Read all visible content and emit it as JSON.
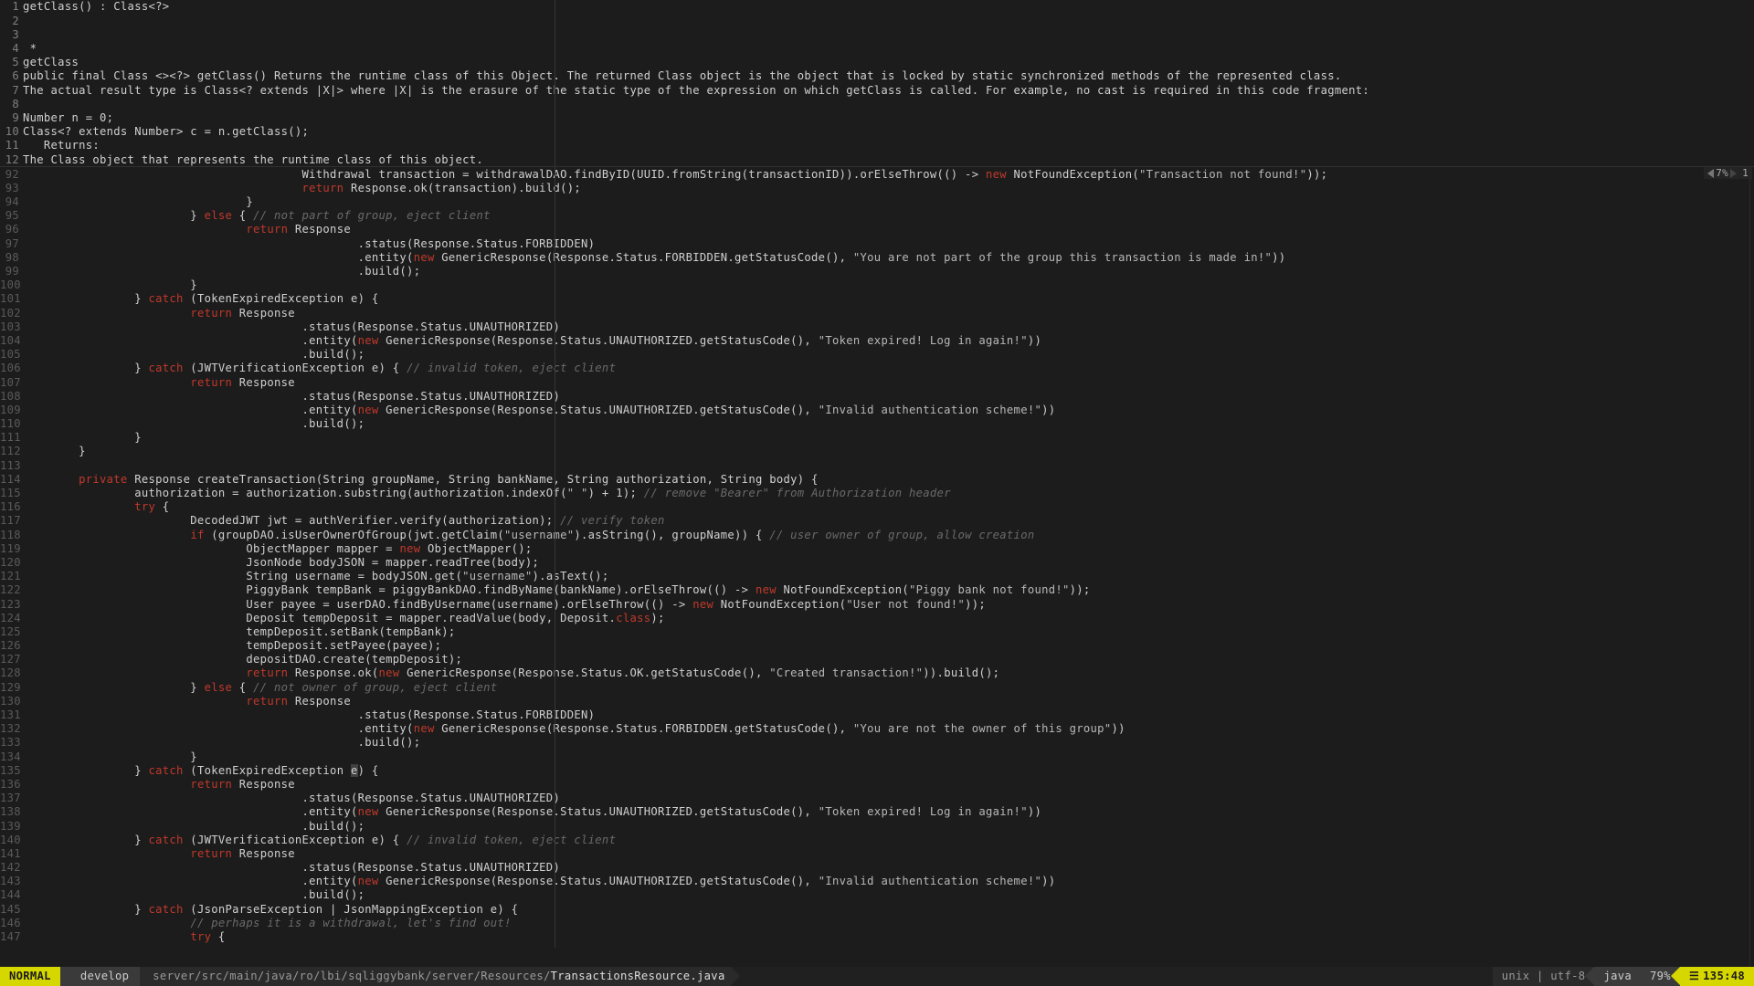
{
  "status": {
    "mode": "NORMAL",
    "branch_icon": "",
    "branch": "develop",
    "path_prefix": "server/src/main/java/ro/lbi/sqliggybank/server/Resources/",
    "file": "TransactionsResource.java",
    "encoding": "unix | utf-8",
    "filetype": "java",
    "percent": "79%",
    "position": "135:48"
  },
  "top_indicator": {
    "zoom": "7%",
    "count": "1"
  },
  "preview_lines": [
    {
      "n": "1",
      "tokens": [
        {
          "t": "getClass() : Class<?>",
          "c": ""
        }
      ]
    },
    {
      "n": "2",
      "tokens": []
    },
    {
      "n": "3",
      "tokens": []
    },
    {
      "n": "4",
      "tokens": [
        {
          "t": " *",
          "c": ""
        }
      ]
    },
    {
      "n": "5",
      "tokens": [
        {
          "t": "getClass",
          "c": ""
        }
      ]
    },
    {
      "n": "6",
      "tokens": [
        {
          "t": "public final Class <><?> getClass() Returns the runtime class of this Object. The returned Class object is the object that is locked by static synchronized methods of the represented class.",
          "c": ""
        }
      ]
    },
    {
      "n": "7",
      "tokens": [
        {
          "t": "The actual result type is Class<? extends |X|> where |X| is the erasure of the static type of the expression on which getClass is called. For example, no cast is required in this code fragment:",
          "c": ""
        }
      ]
    },
    {
      "n": "8",
      "tokens": []
    },
    {
      "n": "9",
      "tokens": [
        {
          "t": "Number n = 0;",
          "c": ""
        }
      ]
    },
    {
      "n": "10",
      "tokens": [
        {
          "t": "Class<? extends Number> c = n.getClass();",
          "c": ""
        }
      ]
    },
    {
      "n": "11",
      "tokens": [
        {
          "t": "   Returns:",
          "c": ""
        }
      ]
    },
    {
      "n": "12",
      "tokens": [
        {
          "t": "The Class object that represents the runtime class of this object.",
          "c": ""
        }
      ]
    }
  ],
  "main_lines": [
    {
      "n": "92",
      "tokens": [
        {
          "t": "                                        Withdrawal transaction = withdrawalDAO.findByID(UUID.fromString(transactionID)).orElseThrow(() -> ",
          "c": ""
        },
        {
          "t": "new",
          "c": "kw"
        },
        {
          "t": " NotFoundException(",
          "c": ""
        },
        {
          "t": "\"Transaction not found!\"",
          "c": "str"
        },
        {
          "t": "));",
          "c": ""
        }
      ]
    },
    {
      "n": "93",
      "tokens": [
        {
          "t": "                                        ",
          "c": ""
        },
        {
          "t": "return",
          "c": "kw"
        },
        {
          "t": " Response.ok(transaction).build();",
          "c": ""
        }
      ]
    },
    {
      "n": "94",
      "tokens": [
        {
          "t": "                                }",
          "c": ""
        }
      ]
    },
    {
      "n": "95",
      "tokens": [
        {
          "t": "                        } ",
          "c": ""
        },
        {
          "t": "else",
          "c": "kw"
        },
        {
          "t": " { ",
          "c": ""
        },
        {
          "t": "// not part of group, eject client",
          "c": "cm"
        }
      ]
    },
    {
      "n": "96",
      "tokens": [
        {
          "t": "                                ",
          "c": ""
        },
        {
          "t": "return",
          "c": "kw"
        },
        {
          "t": " Response",
          "c": ""
        }
      ]
    },
    {
      "n": "97",
      "tokens": [
        {
          "t": "                                                .status(Response.Status.FORBIDDEN)",
          "c": ""
        }
      ]
    },
    {
      "n": "98",
      "tokens": [
        {
          "t": "                                                .entity(",
          "c": ""
        },
        {
          "t": "new",
          "c": "kw"
        },
        {
          "t": " GenericResponse(Response.Status.FORBIDDEN.getStatusCode(), ",
          "c": ""
        },
        {
          "t": "\"You are not part of the group this transaction is made in!\"",
          "c": "str"
        },
        {
          "t": "))",
          "c": ""
        }
      ]
    },
    {
      "n": "99",
      "tokens": [
        {
          "t": "                                                .build();",
          "c": ""
        }
      ]
    },
    {
      "n": "100",
      "tokens": [
        {
          "t": "                        }",
          "c": ""
        }
      ]
    },
    {
      "n": "101",
      "tokens": [
        {
          "t": "                } ",
          "c": ""
        },
        {
          "t": "catch",
          "c": "kw"
        },
        {
          "t": " (TokenExpiredException e) {",
          "c": ""
        }
      ]
    },
    {
      "n": "102",
      "tokens": [
        {
          "t": "                        ",
          "c": ""
        },
        {
          "t": "return",
          "c": "kw"
        },
        {
          "t": " Response",
          "c": ""
        }
      ]
    },
    {
      "n": "103",
      "tokens": [
        {
          "t": "                                        .status(Response.Status.UNAUTHORIZED)",
          "c": ""
        }
      ]
    },
    {
      "n": "104",
      "tokens": [
        {
          "t": "                                        .entity(",
          "c": ""
        },
        {
          "t": "new",
          "c": "kw"
        },
        {
          "t": " GenericResponse(Response.Status.UNAUTHORIZED.getStatusCode(), ",
          "c": ""
        },
        {
          "t": "\"Token expired! Log in again!\"",
          "c": "str"
        },
        {
          "t": "))",
          "c": ""
        }
      ]
    },
    {
      "n": "105",
      "tokens": [
        {
          "t": "                                        .build();",
          "c": ""
        }
      ]
    },
    {
      "n": "106",
      "tokens": [
        {
          "t": "                } ",
          "c": ""
        },
        {
          "t": "catch",
          "c": "kw"
        },
        {
          "t": " (JWTVerificationException e) { ",
          "c": ""
        },
        {
          "t": "// invalid token, eject client",
          "c": "cm"
        }
      ]
    },
    {
      "n": "107",
      "tokens": [
        {
          "t": "                        ",
          "c": ""
        },
        {
          "t": "return",
          "c": "kw"
        },
        {
          "t": " Response",
          "c": ""
        }
      ]
    },
    {
      "n": "108",
      "tokens": [
        {
          "t": "                                        .status(Response.Status.UNAUTHORIZED)",
          "c": ""
        }
      ]
    },
    {
      "n": "109",
      "tokens": [
        {
          "t": "                                        .entity(",
          "c": ""
        },
        {
          "t": "new",
          "c": "kw"
        },
        {
          "t": " GenericResponse(Response.Status.UNAUTHORIZED.getStatusCode(), ",
          "c": ""
        },
        {
          "t": "\"Invalid authentication scheme!\"",
          "c": "str"
        },
        {
          "t": "))",
          "c": ""
        }
      ]
    },
    {
      "n": "110",
      "tokens": [
        {
          "t": "                                        .build();",
          "c": ""
        }
      ]
    },
    {
      "n": "111",
      "tokens": [
        {
          "t": "                }",
          "c": ""
        }
      ]
    },
    {
      "n": "112",
      "tokens": [
        {
          "t": "        }",
          "c": ""
        }
      ]
    },
    {
      "n": "113",
      "tokens": []
    },
    {
      "n": "114",
      "tokens": [
        {
          "t": "        ",
          "c": ""
        },
        {
          "t": "private",
          "c": "kw"
        },
        {
          "t": " Response createTransaction(String groupName, String bankName, String authorization, String body) {",
          "c": ""
        }
      ]
    },
    {
      "n": "115",
      "tokens": [
        {
          "t": "                authorization = authorization.substring(authorization.indexOf(",
          "c": ""
        },
        {
          "t": "\" \"",
          "c": "str"
        },
        {
          "t": ") + ",
          "c": ""
        },
        {
          "t": "1",
          "c": ""
        },
        {
          "t": "); ",
          "c": ""
        },
        {
          "t": "// remove \"Bearer\" from Authorization header",
          "c": "cm"
        }
      ]
    },
    {
      "n": "116",
      "tokens": [
        {
          "t": "                ",
          "c": ""
        },
        {
          "t": "try",
          "c": "kw"
        },
        {
          "t": " {",
          "c": ""
        }
      ]
    },
    {
      "n": "117",
      "tokens": [
        {
          "t": "                        DecodedJWT jwt = authVerifier.verify(authorization); ",
          "c": ""
        },
        {
          "t": "// verify token",
          "c": "cm"
        }
      ]
    },
    {
      "n": "118",
      "tokens": [
        {
          "t": "                        ",
          "c": ""
        },
        {
          "t": "if",
          "c": "kw"
        },
        {
          "t": " (groupDAO.isUserOwnerOfGroup(jwt.getClaim(",
          "c": ""
        },
        {
          "t": "\"username\"",
          "c": "str"
        },
        {
          "t": ").asString(), groupName)) { ",
          "c": ""
        },
        {
          "t": "// user owner of group, allow creation",
          "c": "cm"
        }
      ]
    },
    {
      "n": "119",
      "tokens": [
        {
          "t": "                                ObjectMapper mapper = ",
          "c": ""
        },
        {
          "t": "new",
          "c": "kw"
        },
        {
          "t": " ObjectMapper();",
          "c": ""
        }
      ]
    },
    {
      "n": "120",
      "tokens": [
        {
          "t": "                                JsonNode bodyJSON = mapper.readTree(body);",
          "c": ""
        }
      ]
    },
    {
      "n": "121",
      "tokens": [
        {
          "t": "                                String username = bodyJSON.get(",
          "c": ""
        },
        {
          "t": "\"username\"",
          "c": "str"
        },
        {
          "t": ").asText();",
          "c": ""
        }
      ]
    },
    {
      "n": "122",
      "tokens": [
        {
          "t": "                                PiggyBank tempBank = piggyBankDAO.findByName(bankName).orElseThrow(() -> ",
          "c": ""
        },
        {
          "t": "new",
          "c": "kw"
        },
        {
          "t": " NotFoundException(",
          "c": ""
        },
        {
          "t": "\"Piggy bank not found!\"",
          "c": "str"
        },
        {
          "t": "));",
          "c": ""
        }
      ]
    },
    {
      "n": "123",
      "tokens": [
        {
          "t": "                                User payee = userDAO.findByUsername(username).orElseThrow(() -> ",
          "c": ""
        },
        {
          "t": "new",
          "c": "kw"
        },
        {
          "t": " NotFoundException(",
          "c": ""
        },
        {
          "t": "\"User not found!\"",
          "c": "str"
        },
        {
          "t": "));",
          "c": ""
        }
      ]
    },
    {
      "n": "124",
      "tokens": [
        {
          "t": "                                Deposit tempDeposit = mapper.readValue(body, Deposit.",
          "c": ""
        },
        {
          "t": "class",
          "c": "kw"
        },
        {
          "t": ");",
          "c": ""
        }
      ]
    },
    {
      "n": "125",
      "tokens": [
        {
          "t": "                                tempDeposit.setBank(tempBank);",
          "c": ""
        }
      ]
    },
    {
      "n": "126",
      "tokens": [
        {
          "t": "                                tempDeposit.setPayee(payee);",
          "c": ""
        }
      ]
    },
    {
      "n": "127",
      "tokens": [
        {
          "t": "                                depositDAO.create(tempDeposit);",
          "c": ""
        }
      ]
    },
    {
      "n": "128",
      "tokens": [
        {
          "t": "                                ",
          "c": ""
        },
        {
          "t": "return",
          "c": "kw"
        },
        {
          "t": " Response.ok(",
          "c": ""
        },
        {
          "t": "new",
          "c": "kw"
        },
        {
          "t": " GenericResponse(Response.Status.OK.getStatusCode(), ",
          "c": ""
        },
        {
          "t": "\"Created transaction!\"",
          "c": "str"
        },
        {
          "t": ")).build();",
          "c": ""
        }
      ]
    },
    {
      "n": "129",
      "tokens": [
        {
          "t": "                        } ",
          "c": ""
        },
        {
          "t": "else",
          "c": "kw"
        },
        {
          "t": " { ",
          "c": ""
        },
        {
          "t": "// not owner of group, eject client",
          "c": "cm"
        }
      ]
    },
    {
      "n": "130",
      "tokens": [
        {
          "t": "                                ",
          "c": ""
        },
        {
          "t": "return",
          "c": "kw"
        },
        {
          "t": " Response",
          "c": ""
        }
      ]
    },
    {
      "n": "131",
      "tokens": [
        {
          "t": "                                                .status(Response.Status.FORBIDDEN)",
          "c": ""
        }
      ]
    },
    {
      "n": "132",
      "tokens": [
        {
          "t": "                                                .entity(",
          "c": ""
        },
        {
          "t": "new",
          "c": "kw"
        },
        {
          "t": " GenericResponse(Response.Status.FORBIDDEN.getStatusCode(), ",
          "c": ""
        },
        {
          "t": "\"You are not the owner of this group\"",
          "c": "str"
        },
        {
          "t": "))",
          "c": ""
        }
      ]
    },
    {
      "n": "133",
      "tokens": [
        {
          "t": "                                                .build();",
          "c": ""
        }
      ]
    },
    {
      "n": "134",
      "tokens": [
        {
          "t": "                        }",
          "c": ""
        }
      ]
    },
    {
      "n": "135",
      "tokens": [
        {
          "t": "                } ",
          "c": ""
        },
        {
          "t": "catch",
          "c": "kw"
        },
        {
          "t": " (TokenExpiredException ",
          "c": ""
        },
        {
          "t": "e",
          "c": "cursor-mark"
        },
        {
          "t": ") {",
          "c": ""
        }
      ]
    },
    {
      "n": "136",
      "tokens": [
        {
          "t": "                        ",
          "c": ""
        },
        {
          "t": "return",
          "c": "kw"
        },
        {
          "t": " Response",
          "c": ""
        }
      ]
    },
    {
      "n": "137",
      "tokens": [
        {
          "t": "                                        .status(Response.Status.UNAUTHORIZED)",
          "c": ""
        }
      ]
    },
    {
      "n": "138",
      "tokens": [
        {
          "t": "                                        .entity(",
          "c": ""
        },
        {
          "t": "new",
          "c": "kw"
        },
        {
          "t": " GenericResponse(Response.Status.UNAUTHORIZED.getStatusCode(), ",
          "c": ""
        },
        {
          "t": "\"Token expired! Log in again!\"",
          "c": "str"
        },
        {
          "t": "))",
          "c": ""
        }
      ]
    },
    {
      "n": "139",
      "tokens": [
        {
          "t": "                                        .build();",
          "c": ""
        }
      ]
    },
    {
      "n": "140",
      "tokens": [
        {
          "t": "                } ",
          "c": ""
        },
        {
          "t": "catch",
          "c": "kw"
        },
        {
          "t": " (JWTVerificationException e) { ",
          "c": ""
        },
        {
          "t": "// invalid token, eject client",
          "c": "cm"
        }
      ]
    },
    {
      "n": "141",
      "tokens": [
        {
          "t": "                        ",
          "c": ""
        },
        {
          "t": "return",
          "c": "kw"
        },
        {
          "t": " Response",
          "c": ""
        }
      ]
    },
    {
      "n": "142",
      "tokens": [
        {
          "t": "                                        .status(Response.Status.UNAUTHORIZED)",
          "c": ""
        }
      ]
    },
    {
      "n": "143",
      "tokens": [
        {
          "t": "                                        .entity(",
          "c": ""
        },
        {
          "t": "new",
          "c": "kw"
        },
        {
          "t": " GenericResponse(Response.Status.UNAUTHORIZED.getStatusCode(), ",
          "c": ""
        },
        {
          "t": "\"Invalid authentication scheme!\"",
          "c": "str"
        },
        {
          "t": "))",
          "c": ""
        }
      ]
    },
    {
      "n": "144",
      "tokens": [
        {
          "t": "                                        .build();",
          "c": ""
        }
      ]
    },
    {
      "n": "145",
      "tokens": [
        {
          "t": "                } ",
          "c": ""
        },
        {
          "t": "catch",
          "c": "kw"
        },
        {
          "t": " (JsonParseException | JsonMappingException e) {",
          "c": ""
        }
      ]
    },
    {
      "n": "146",
      "tokens": [
        {
          "t": "                        ",
          "c": ""
        },
        {
          "t": "// perhaps it is a withdrawal, let's find out!",
          "c": "cm"
        }
      ]
    },
    {
      "n": "147",
      "tokens": [
        {
          "t": "                        ",
          "c": ""
        },
        {
          "t": "try",
          "c": "kw"
        },
        {
          "t": " {",
          "c": ""
        }
      ]
    }
  ]
}
